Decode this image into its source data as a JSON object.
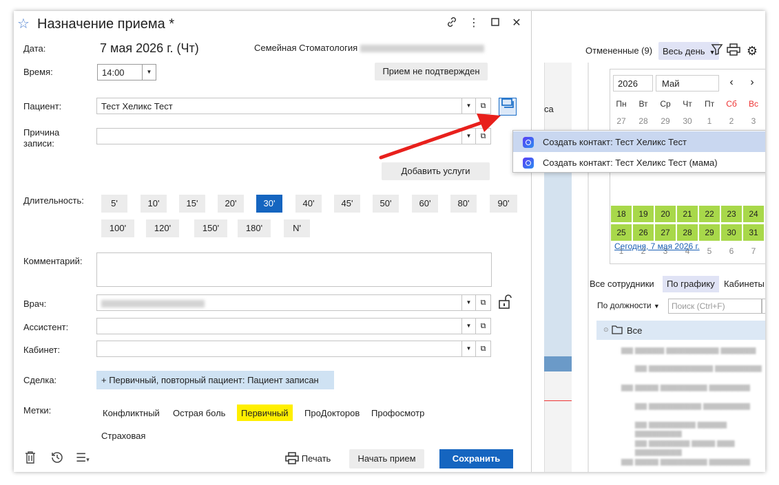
{
  "dialog": {
    "title": "Назначение приема *",
    "date_label": "Дата:",
    "date_value": "7 мая 2026 г. (Чт)",
    "clinic_name": "Семейная Стоматология",
    "time_label": "Время:",
    "time_value": "14:00",
    "status_button": "Прием не подтвержден",
    "patient_label": "Пациент:",
    "patient_value": "Тест Хеликс Тест",
    "reason_label_1": "Причина",
    "reason_label_2": "записи:",
    "add_services_button": "Добавить услуги",
    "duration_label": "Длительность:",
    "durations": [
      "5'",
      "10'",
      "15'",
      "20'",
      "30'",
      "40'",
      "45'",
      "50'",
      "60'",
      "80'",
      "90'",
      "100'",
      "120'",
      "150'",
      "180'",
      "N'"
    ],
    "duration_selected": "30'",
    "comment_label": "Комментарий:",
    "doctor_label": "Врач:",
    "assistant_label": "Ассистент:",
    "cabinet_label": "Кабинет:",
    "deal_label": "Сделка:",
    "deal_value": "+ Первичный, повторный пациент: Пациент записан",
    "tags_label": "Метки:",
    "tags": [
      "Конфликтный",
      "Острая боль",
      "Первичный",
      "ПроДокторов",
      "Профосмотр",
      "Страховая"
    ],
    "tag_highlighted": "Первичный",
    "print_button": "Печать",
    "start_button": "Начать прием",
    "save_button": "Сохранить"
  },
  "contact_menu": {
    "items": [
      "Создать контакт: Тест Хеликс Тест",
      "Создать контакт: Тест Хеликс Тест (мама)"
    ]
  },
  "right_panel": {
    "cancelled": "Отмененные (9)",
    "range_select": "Весь день",
    "partial_text": "са",
    "calendar": {
      "year": "2026",
      "month": "Май",
      "weekdays": [
        "Пн",
        "Вт",
        "Ср",
        "Чт",
        "Пт",
        "Сб",
        "Вс"
      ],
      "row1": [
        "27",
        "28",
        "29",
        "30",
        "1",
        "2",
        "3"
      ],
      "row_green1": [
        "18",
        "19",
        "20",
        "21",
        "22",
        "23",
        "24"
      ],
      "row_green2": [
        "25",
        "26",
        "27",
        "28",
        "29",
        "30",
        "31"
      ],
      "row_last": [
        "1",
        "2",
        "3",
        "4",
        "5",
        "6",
        "7"
      ],
      "today_link": "Сегодня, 7 мая 2026 г."
    },
    "staff_tabs": [
      "Все сотрудники",
      "По графику",
      "Кабинеты"
    ],
    "staff_tab_active": "По графику",
    "filter_label": "По должности",
    "search_placeholder": "Поиск (Ctrl+F)",
    "tree_root": "Все"
  },
  "colors": {
    "accent": "#1565c0",
    "calendar_green": "#a8d84a",
    "tag_yellow": "#ffef00",
    "deal_blue": "#cfe2f3",
    "arrow_red": "#e8201c"
  }
}
